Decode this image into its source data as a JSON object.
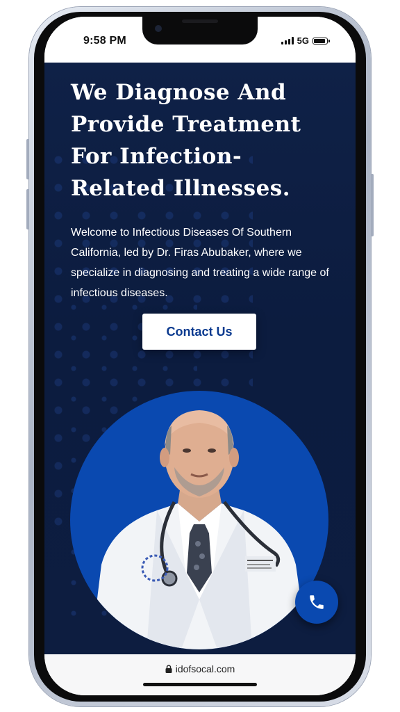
{
  "status_bar": {
    "time": "9:58 PM",
    "network": "5G"
  },
  "hero": {
    "title": "We Diagnose And Provide Treatment For Infection-Related Illnesses.",
    "description": "Welcome to Infectious Diseases Of Southern California, led by Dr. Firas Abubaker, where we specialize in diagnosing and treating a wide range of infectious diseases.",
    "cta_label": "Contact Us"
  },
  "browser": {
    "url": "idofsocal.com"
  },
  "icons": {
    "lock": "lock-icon",
    "phone": "phone-icon",
    "signal": "signal-icon",
    "battery": "battery-icon"
  },
  "colors": {
    "navy": "#0f2147",
    "accent_blue": "#0a49b0",
    "button_text": "#0b3a8f"
  }
}
